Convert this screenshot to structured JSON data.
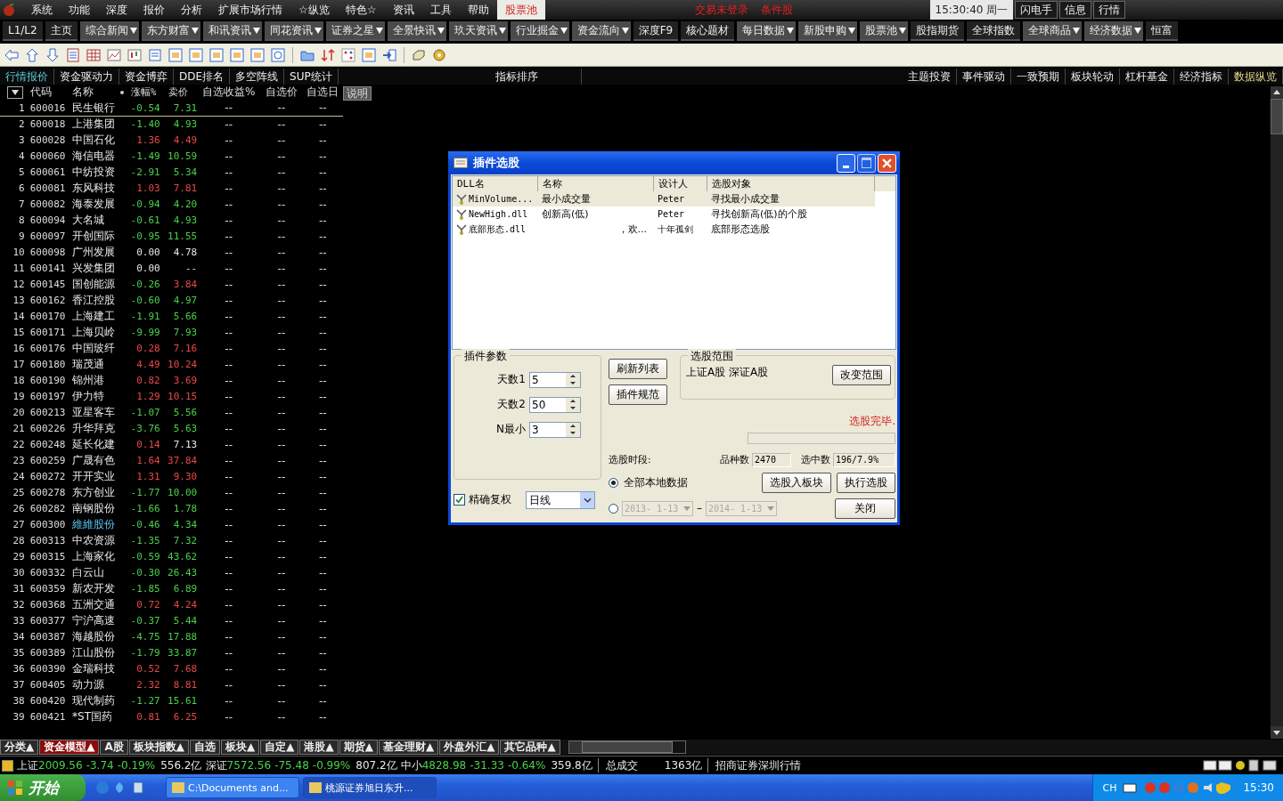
{
  "menu_bar": {
    "items": [
      {
        "label": "系统",
        "selected": false
      },
      {
        "label": "功能",
        "selected": false
      },
      {
        "label": "深度",
        "selected": false
      },
      {
        "label": "报价",
        "selected": false
      },
      {
        "label": "分析",
        "selected": false
      },
      {
        "label": "扩展市场行情",
        "selected": false
      },
      {
        "label": "☆纵览",
        "selected": false
      },
      {
        "label": "特色☆",
        "selected": false
      },
      {
        "label": "资讯",
        "selected": false
      },
      {
        "label": "工具",
        "selected": false
      },
      {
        "label": "帮助",
        "selected": false
      },
      {
        "label": "股票池",
        "selected": true
      }
    ],
    "alerts": [
      "交易未登录",
      "条件股"
    ],
    "clock": "15:30:40 周一",
    "buttons": [
      "闪电手",
      "信息",
      "行情"
    ]
  },
  "nav_bar": [
    {
      "label": "L1/L2",
      "dropdown": false
    },
    {
      "label": "主页",
      "dropdown": false
    },
    {
      "label": "综合新闻",
      "dropdown": true
    },
    {
      "label": "东方财富",
      "dropdown": true
    },
    {
      "label": "和讯资讯",
      "dropdown": true
    },
    {
      "label": "同花资讯",
      "dropdown": true
    },
    {
      "label": "证券之星",
      "dropdown": true
    },
    {
      "label": "全景快讯",
      "dropdown": true
    },
    {
      "label": "玖天资讯",
      "dropdown": true
    },
    {
      "label": "行业掘金",
      "dropdown": true
    },
    {
      "label": "资金流向",
      "dropdown": true
    },
    {
      "label": "深度F9",
      "dropdown": false
    },
    {
      "label": "核心题材",
      "dropdown": false
    },
    {
      "label": "每日数据",
      "dropdown": true
    },
    {
      "label": "新股申购",
      "dropdown": true
    },
    {
      "label": "股票池",
      "dropdown": true
    },
    {
      "label": "股指期货",
      "dropdown": false
    },
    {
      "label": "全球指数",
      "dropdown": false
    },
    {
      "label": "全球商品",
      "dropdown": true
    },
    {
      "label": "经济数据",
      "dropdown": true
    },
    {
      "label": "恒富",
      "dropdown": false
    }
  ],
  "tabs_left": [
    {
      "label": "行情报价",
      "selected": true
    },
    {
      "label": "资金驱动力",
      "selected": false
    },
    {
      "label": "资金博弈",
      "selected": false
    },
    {
      "label": "DDE排名",
      "selected": false
    },
    {
      "label": "多空阵线",
      "selected": false
    },
    {
      "label": "SUP统计",
      "selected": false
    },
    {
      "label": "指标排序",
      "selected": false
    }
  ],
  "tabs_right": [
    {
      "label": "主题投资",
      "selected": false
    },
    {
      "label": "事件驱动",
      "selected": false
    },
    {
      "label": "一致预期",
      "selected": false
    },
    {
      "label": "板块轮动",
      "selected": false
    },
    {
      "label": "杠杆基金",
      "selected": false
    },
    {
      "label": "经济指标",
      "selected": false
    },
    {
      "label": "数据纵览",
      "selected": true
    }
  ],
  "table": {
    "columns": [
      "代码",
      "名称",
      "涨幅%",
      "卖价",
      "自选收益%",
      "自选价",
      "自选日"
    ],
    "note_button": "说明",
    "rows": [
      {
        "no": "1",
        "code": "600016",
        "name": "民生银行",
        "change": {
          "text": "-0.54",
          "color": "#4ad04a"
        },
        "price": {
          "text": "7.31",
          "color": "#4ad04a"
        },
        "return": "--",
        "watch_price": "--",
        "watch_date": "--",
        "selected": true,
        "marked": false
      },
      {
        "no": "2",
        "code": "600018",
        "name": "上港集团",
        "change": {
          "text": "-1.40",
          "color": "#4ad04a"
        },
        "price": {
          "text": "4.93",
          "color": "#4ad04a"
        },
        "return": "--",
        "watch_price": "--",
        "watch_date": "--",
        "selected": false,
        "marked": false
      },
      {
        "no": "3",
        "code": "600028",
        "name": "中国石化",
        "change": {
          "text": "1.36",
          "color": "#e84848"
        },
        "price": {
          "text": "4.49",
          "color": "#e84848"
        },
        "return": "--",
        "watch_price": "--",
        "watch_date": "--",
        "selected": false,
        "marked": false
      },
      {
        "no": "4",
        "code": "600060",
        "name": "海信电器",
        "change": {
          "text": "-1.49",
          "color": "#4ad04a"
        },
        "price": {
          "text": "10.59",
          "color": "#4ad04a"
        },
        "return": "--",
        "watch_price": "--",
        "watch_date": "--",
        "selected": false,
        "marked": false
      },
      {
        "no": "5",
        "code": "600061",
        "name": "中纺投资",
        "change": {
          "text": "-2.91",
          "color": "#4ad04a"
        },
        "price": {
          "text": "5.34",
          "color": "#4ad04a"
        },
        "return": "--",
        "watch_price": "--",
        "watch_date": "--",
        "selected": false,
        "marked": false
      },
      {
        "no": "6",
        "code": "600081",
        "name": "东风科技",
        "change": {
          "text": "1.03",
          "color": "#e84848"
        },
        "price": {
          "text": "7.81",
          "color": "#e84848"
        },
        "return": "--",
        "watch_price": "--",
        "watch_date": "--",
        "selected": false,
        "marked": false
      },
      {
        "no": "7",
        "code": "600082",
        "name": "海泰发展",
        "change": {
          "text": "-0.94",
          "color": "#4ad04a"
        },
        "price": {
          "text": "4.20",
          "color": "#4ad04a"
        },
        "return": "--",
        "watch_price": "--",
        "watch_date": "--",
        "selected": false,
        "marked": false
      },
      {
        "no": "8",
        "code": "600094",
        "name": "大名城",
        "change": {
          "text": "-0.61",
          "color": "#4ad04a"
        },
        "price": {
          "text": "4.93",
          "color": "#4ad04a"
        },
        "return": "--",
        "watch_price": "--",
        "watch_date": "--",
        "selected": false,
        "marked": false
      },
      {
        "no": "9",
        "code": "600097",
        "name": "开创国际",
        "change": {
          "text": "-0.95",
          "color": "#4ad04a"
        },
        "price": {
          "text": "11.55",
          "color": "#4ad04a"
        },
        "return": "--",
        "watch_price": "--",
        "watch_date": "--",
        "selected": false,
        "marked": false
      },
      {
        "no": "10",
        "code": "600098",
        "name": "广州发展",
        "change": {
          "text": "0.00",
          "color": "#e8e8e8"
        },
        "price": {
          "text": "4.78",
          "color": "#e8e8e8"
        },
        "return": "--",
        "watch_price": "--",
        "watch_date": "--",
        "selected": false,
        "marked": false
      },
      {
        "no": "11",
        "code": "600141",
        "name": "兴发集团",
        "change": {
          "text": "0.00",
          "color": "#e8e8e8"
        },
        "price": {
          "text": "--"
        },
        "return": "--",
        "watch_price": "--",
        "watch_date": "--",
        "selected": false,
        "marked": false
      },
      {
        "no": "12",
        "code": "600145",
        "name": "国创能源",
        "change": {
          "text": "-0.26",
          "color": "#4ad04a"
        },
        "price": {
          "text": "3.84",
          "color": "#e84848"
        },
        "return": "--",
        "watch_price": "--",
        "watch_date": "--",
        "selected": false,
        "marked": false
      },
      {
        "no": "13",
        "code": "600162",
        "name": "香江控股",
        "change": {
          "text": "-0.60",
          "color": "#4ad04a"
        },
        "price": {
          "text": "4.97",
          "color": "#4ad04a"
        },
        "return": "--",
        "watch_price": "--",
        "watch_date": "--",
        "selected": false,
        "marked": false
      },
      {
        "no": "14",
        "code": "600170",
        "name": "上海建工",
        "change": {
          "text": "-1.91",
          "color": "#4ad04a"
        },
        "price": {
          "text": "5.66",
          "color": "#4ad04a"
        },
        "return": "--",
        "watch_price": "--",
        "watch_date": "--",
        "selected": false,
        "marked": false
      },
      {
        "no": "15",
        "code": "600171",
        "name": "上海贝岭",
        "change": {
          "text": "-9.99",
          "color": "#4ad04a"
        },
        "price": {
          "text": "7.93",
          "color": "#4ad04a"
        },
        "return": "--",
        "watch_price": "--",
        "watch_date": "--",
        "selected": false,
        "marked": false
      },
      {
        "no": "16",
        "code": "600176",
        "name": "中国玻纤",
        "change": {
          "text": "0.28",
          "color": "#e84848"
        },
        "price": {
          "text": "7.16",
          "color": "#e84848"
        },
        "return": "--",
        "watch_price": "--",
        "watch_date": "--",
        "selected": false,
        "marked": false
      },
      {
        "no": "17",
        "code": "600180",
        "name": "瑞茂通",
        "change": {
          "text": "4.49",
          "color": "#e84848"
        },
        "price": {
          "text": "10.24",
          "color": "#e84848"
        },
        "return": "--",
        "watch_price": "--",
        "watch_date": "--",
        "selected": false,
        "marked": false
      },
      {
        "no": "18",
        "code": "600190",
        "name": "锦州港",
        "change": {
          "text": "0.82",
          "color": "#e84848"
        },
        "price": {
          "text": "3.69",
          "color": "#e84848"
        },
        "return": "--",
        "watch_price": "--",
        "watch_date": "--",
        "selected": false,
        "marked": false
      },
      {
        "no": "19",
        "code": "600197",
        "name": "伊力特",
        "change": {
          "text": "1.29",
          "color": "#e84848"
        },
        "price": {
          "text": "10.15",
          "color": "#e84848"
        },
        "return": "--",
        "watch_price": "--",
        "watch_date": "--",
        "selected": false,
        "marked": false
      },
      {
        "no": "20",
        "code": "600213",
        "name": "亚星客车",
        "change": {
          "text": "-1.07",
          "color": "#4ad04a"
        },
        "price": {
          "text": "5.56",
          "color": "#4ad04a"
        },
        "return": "--",
        "watch_price": "--",
        "watch_date": "--",
        "selected": false,
        "marked": false
      },
      {
        "no": "21",
        "code": "600226",
        "name": "升华拜克",
        "change": {
          "text": "-3.76",
          "color": "#4ad04a"
        },
        "price": {
          "text": "5.63",
          "color": "#4ad04a"
        },
        "return": "--",
        "watch_price": "--",
        "watch_date": "--",
        "selected": false,
        "marked": false
      },
      {
        "no": "22",
        "code": "600248",
        "name": "延长化建",
        "change": {
          "text": "0.14",
          "color": "#e84848"
        },
        "price": {
          "text": "7.13",
          "color": "#e8e8e8"
        },
        "return": "--",
        "watch_price": "--",
        "watch_date": "--",
        "selected": false,
        "marked": false
      },
      {
        "no": "23",
        "code": "600259",
        "name": "广晟有色",
        "change": {
          "text": "1.64",
          "color": "#e84848"
        },
        "price": {
          "text": "37.84",
          "color": "#e84848"
        },
        "return": "--",
        "watch_price": "--",
        "watch_date": "--",
        "selected": false,
        "marked": false
      },
      {
        "no": "24",
        "code": "600272",
        "name": "开开实业",
        "change": {
          "text": "1.31",
          "color": "#e84848"
        },
        "price": {
          "text": "9.30",
          "color": "#e84848"
        },
        "return": "--",
        "watch_price": "--",
        "watch_date": "--",
        "selected": false,
        "marked": false
      },
      {
        "no": "25",
        "code": "600278",
        "name": "东方创业",
        "change": {
          "text": "-1.77",
          "color": "#4ad04a"
        },
        "price": {
          "text": "10.00",
          "color": "#4ad04a"
        },
        "return": "--",
        "watch_price": "--",
        "watch_date": "--",
        "selected": false,
        "marked": false
      },
      {
        "no": "26",
        "code": "600282",
        "name": "南钢股份",
        "change": {
          "text": "-1.66",
          "color": "#4ad04a"
        },
        "price": {
          "text": "1.78",
          "color": "#4ad04a"
        },
        "return": "--",
        "watch_price": "--",
        "watch_date": "--",
        "selected": false,
        "marked": false
      },
      {
        "no": "27",
        "code": "600300",
        "name": "維維股份",
        "change": {
          "text": "-0.46",
          "color": "#4ad04a"
        },
        "price": {
          "text": "4.34",
          "color": "#4ad04a"
        },
        "return": "--",
        "watch_price": "--",
        "watch_date": "--",
        "selected": false,
        "marked": true
      },
      {
        "no": "28",
        "code": "600313",
        "name": "中农资源",
        "change": {
          "text": "-1.35",
          "color": "#4ad04a"
        },
        "price": {
          "text": "7.32",
          "color": "#4ad04a"
        },
        "return": "--",
        "watch_price": "--",
        "watch_date": "--",
        "selected": false,
        "marked": false
      },
      {
        "no": "29",
        "code": "600315",
        "name": "上海家化",
        "change": {
          "text": "-0.59",
          "color": "#4ad04a"
        },
        "price": {
          "text": "43.62",
          "color": "#4ad04a"
        },
        "return": "--",
        "watch_price": "--",
        "watch_date": "--",
        "selected": false,
        "marked": false
      },
      {
        "no": "30",
        "code": "600332",
        "name": "白云山",
        "change": {
          "text": "-0.30",
          "color": "#4ad04a"
        },
        "price": {
          "text": "26.43",
          "color": "#4ad04a"
        },
        "return": "--",
        "watch_price": "--",
        "watch_date": "--",
        "selected": false,
        "marked": false
      },
      {
        "no": "31",
        "code": "600359",
        "name": "新农开发",
        "change": {
          "text": "-1.85",
          "color": "#4ad04a"
        },
        "price": {
          "text": "6.89",
          "color": "#4ad04a"
        },
        "return": "--",
        "watch_price": "--",
        "watch_date": "--",
        "selected": false,
        "marked": false
      },
      {
        "no": "32",
        "code": "600368",
        "name": "五洲交通",
        "change": {
          "text": "0.72",
          "color": "#e84848"
        },
        "price": {
          "text": "4.24",
          "color": "#e84848"
        },
        "return": "--",
        "watch_price": "--",
        "watch_date": "--",
        "selected": false,
        "marked": false
      },
      {
        "no": "33",
        "code": "600377",
        "name": "宁沪高速",
        "change": {
          "text": "-0.37",
          "color": "#4ad04a"
        },
        "price": {
          "text": "5.44",
          "color": "#4ad04a"
        },
        "return": "--",
        "watch_price": "--",
        "watch_date": "--",
        "selected": false,
        "marked": false
      },
      {
        "no": "34",
        "code": "600387",
        "name": "海越股份",
        "change": {
          "text": "-4.75",
          "color": "#4ad04a"
        },
        "price": {
          "text": "17.88",
          "color": "#4ad04a"
        },
        "return": "--",
        "watch_price": "--",
        "watch_date": "--",
        "selected": false,
        "marked": false
      },
      {
        "no": "35",
        "code": "600389",
        "name": "江山股份",
        "change": {
          "text": "-1.79",
          "color": "#4ad04a"
        },
        "price": {
          "text": "33.87",
          "color": "#4ad04a"
        },
        "return": "--",
        "watch_price": "--",
        "watch_date": "--",
        "selected": false,
        "marked": false
      },
      {
        "no": "36",
        "code": "600390",
        "name": "金瑞科技",
        "change": {
          "text": "0.52",
          "color": "#e84848"
        },
        "price": {
          "text": "7.68",
          "color": "#e84848"
        },
        "return": "--",
        "watch_price": "--",
        "watch_date": "--",
        "selected": false,
        "marked": false
      },
      {
        "no": "37",
        "code": "600405",
        "name": "动力源",
        "change": {
          "text": "2.32",
          "color": "#e84848"
        },
        "price": {
          "text": "8.81",
          "color": "#e84848"
        },
        "return": "--",
        "watch_price": "--",
        "watch_date": "--",
        "selected": false,
        "marked": false
      },
      {
        "no": "38",
        "code": "600420",
        "name": "现代制药",
        "change": {
          "text": "-1.27",
          "color": "#4ad04a"
        },
        "price": {
          "text": "15.61",
          "color": "#4ad04a"
        },
        "return": "--",
        "watch_price": "--",
        "watch_date": "--",
        "selected": false,
        "marked": false
      },
      {
        "no": "39",
        "code": "600421",
        "name": "*ST国药",
        "change": {
          "text": "0.81",
          "color": "#e84848"
        },
        "price": {
          "text": "6.25",
          "color": "#e84848"
        },
        "return": "--",
        "watch_price": "--",
        "watch_date": "--",
        "selected": false,
        "marked": false
      }
    ]
  },
  "dialog": {
    "title": "插件选股",
    "list": {
      "columns": [
        "DLL名",
        "名称",
        "设计人",
        "选股对象"
      ],
      "rows": [
        {
          "dll": "MinVolume...",
          "name": "最小成交量",
          "designer": "Peter",
          "target": "寻找最小成交量",
          "selected": true
        },
        {
          "dll": "NewHigh.dll",
          "name": "创新高(低)",
          "designer": "Peter",
          "target": "寻找创新高(低)的个股",
          "selected": false
        },
        {
          "dll": "底部形态.dll",
          "name": "，欢...",
          "designer": "十年孤剑",
          "target": "底部形态选股",
          "selected": false
        }
      ]
    },
    "params": {
      "title": "插件参数",
      "fields": [
        {
          "label": "天数1",
          "value": "5"
        },
        {
          "label": "天数2",
          "value": "50"
        },
        {
          "label": "N最小",
          "value": "3"
        }
      ]
    },
    "refresh_button": "刷新列表",
    "spec_button": "插件规范",
    "range": {
      "title": "选股范围",
      "text": "上证A股 深证A股",
      "button": "改变范围"
    },
    "status": "选股完毕.",
    "progress": {
      "level": 0
    },
    "period_label": "选股时段:",
    "count_label": "品种数",
    "count": "2470",
    "picked_label": "选中数",
    "picked": "196/7.9%",
    "radios": [
      {
        "label": "全部本地数据",
        "selected": true
      },
      {
        "selected": false
      }
    ],
    "date_from": "2013- 1-13",
    "date_sep": "–",
    "date_to": "2014- 1-13",
    "to_block_button": "选股入板块",
    "run_button": "执行选股",
    "close_button": "关闭",
    "exact_adjust": {
      "label": "精确复权",
      "checked": true
    },
    "period_select": "日线"
  },
  "bottom_tabs": [
    {
      "label": "分类▲",
      "selected": false
    },
    {
      "label": "资金模型▲",
      "selected": true
    },
    {
      "label": "A股",
      "selected": false
    },
    {
      "label": "板块指数▲",
      "selected": false
    },
    {
      "label": "自选",
      "selected": false
    },
    {
      "label": "板块▲",
      "selected": false
    },
    {
      "label": "自定▲",
      "selected": false
    },
    {
      "label": "港股▲",
      "selected": false
    },
    {
      "label": "期货▲",
      "selected": false
    },
    {
      "label": "基金理财▲",
      "selected": false
    },
    {
      "label": "外盘外汇▲",
      "selected": false
    },
    {
      "label": "其它品种▲",
      "selected": false
    }
  ],
  "status_bar": {
    "indices": [
      {
        "name": "上证",
        "value": "2009.56",
        "change": "-3.74",
        "percent": "-0.19%",
        "amount": "556.2亿",
        "color": "#4ad04a"
      },
      {
        "name": "深证",
        "value": "7572.56",
        "change": "-75.48",
        "percent": "-0.99%",
        "amount": "807.2亿",
        "color": "#4ad04a"
      },
      {
        "name": "中小",
        "value": "4828.98",
        "change": "-31.33",
        "percent": "-0.64%",
        "amount": "359.8亿",
        "color": "#4ad04a"
      }
    ],
    "total_label": "总成交",
    "total": "1363亿",
    "source": "招商证券深圳行情"
  },
  "taskbar": {
    "start": "开始",
    "tasks": [
      {
        "label": "C:\\Documents and...",
        "selected": false
      },
      {
        "label": "桃源证券旭日东升...",
        "selected": true
      }
    ],
    "lang": "CH",
    "clock": "15:30"
  }
}
